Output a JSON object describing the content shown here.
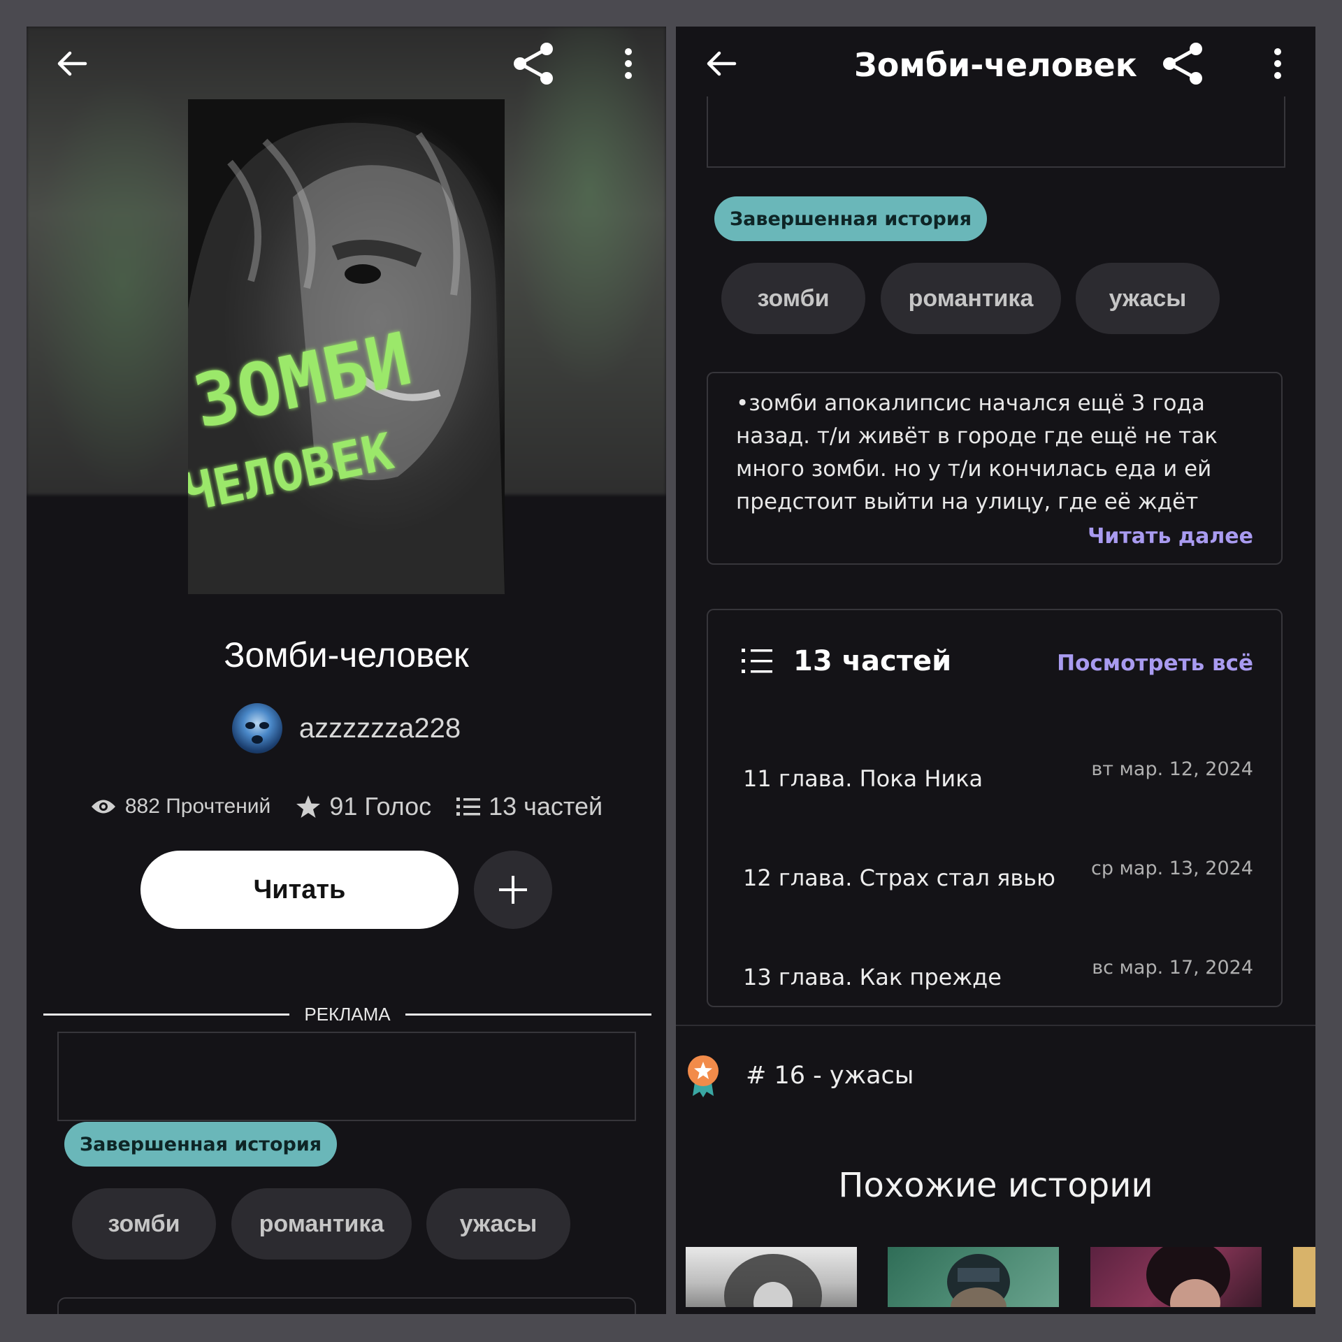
{
  "left": {
    "book_title": "Зомби-человек",
    "author": "azzzzzza228",
    "stats": {
      "reads": "882 Прочтений",
      "votes": "91 Голос",
      "parts": "13 частей"
    },
    "read_button": "Читать",
    "ad_label": "РЕКЛАМА",
    "status_badge": "Завершенная история",
    "tags": [
      "зомби",
      "романтика",
      "ужасы"
    ],
    "cover_text": [
      "ЗОМБИ",
      "ЧЕЛОВЕК"
    ]
  },
  "right": {
    "header_title": "Зомби-человек",
    "status_badge": "Завершенная история",
    "tags": [
      "зомби",
      "романтика",
      "ужасы"
    ],
    "description": "•зомби апокалипсис начался ещё 3 года назад. т/и живёт в городе где ещё не так много зомби. но у т/и кончилась еда и ей предстоит выйти на улицу, где её ждёт",
    "read_more": "Читать далее",
    "parts": {
      "title": "13 частей",
      "see_all": "Посмотреть всё",
      "chapters": [
        {
          "title": "11 глава. Пока Ника",
          "date": "вт мар. 12, 2024"
        },
        {
          "title": "12 глава. Страх стал явью",
          "date": "ср мар. 13, 2024"
        },
        {
          "title": "13 глава. Как прежде",
          "date": "вс мар. 17, 2024"
        }
      ]
    },
    "ranking": "# 16 - ужасы",
    "similar_title": "Похожие истории"
  },
  "colors": {
    "panel_bg": "#141317",
    "frame_bg": "#4b4a50",
    "badge": "#6ab7b9",
    "link": "#a99bf0",
    "tag_bg": "#2c2b30",
    "cover_text": "#9be86a"
  },
  "icons": [
    "back-arrow-icon",
    "share-icon",
    "more-vertical-icon",
    "eye-icon",
    "star-icon",
    "list-icon",
    "plus-icon",
    "award-ribbon-icon"
  ]
}
